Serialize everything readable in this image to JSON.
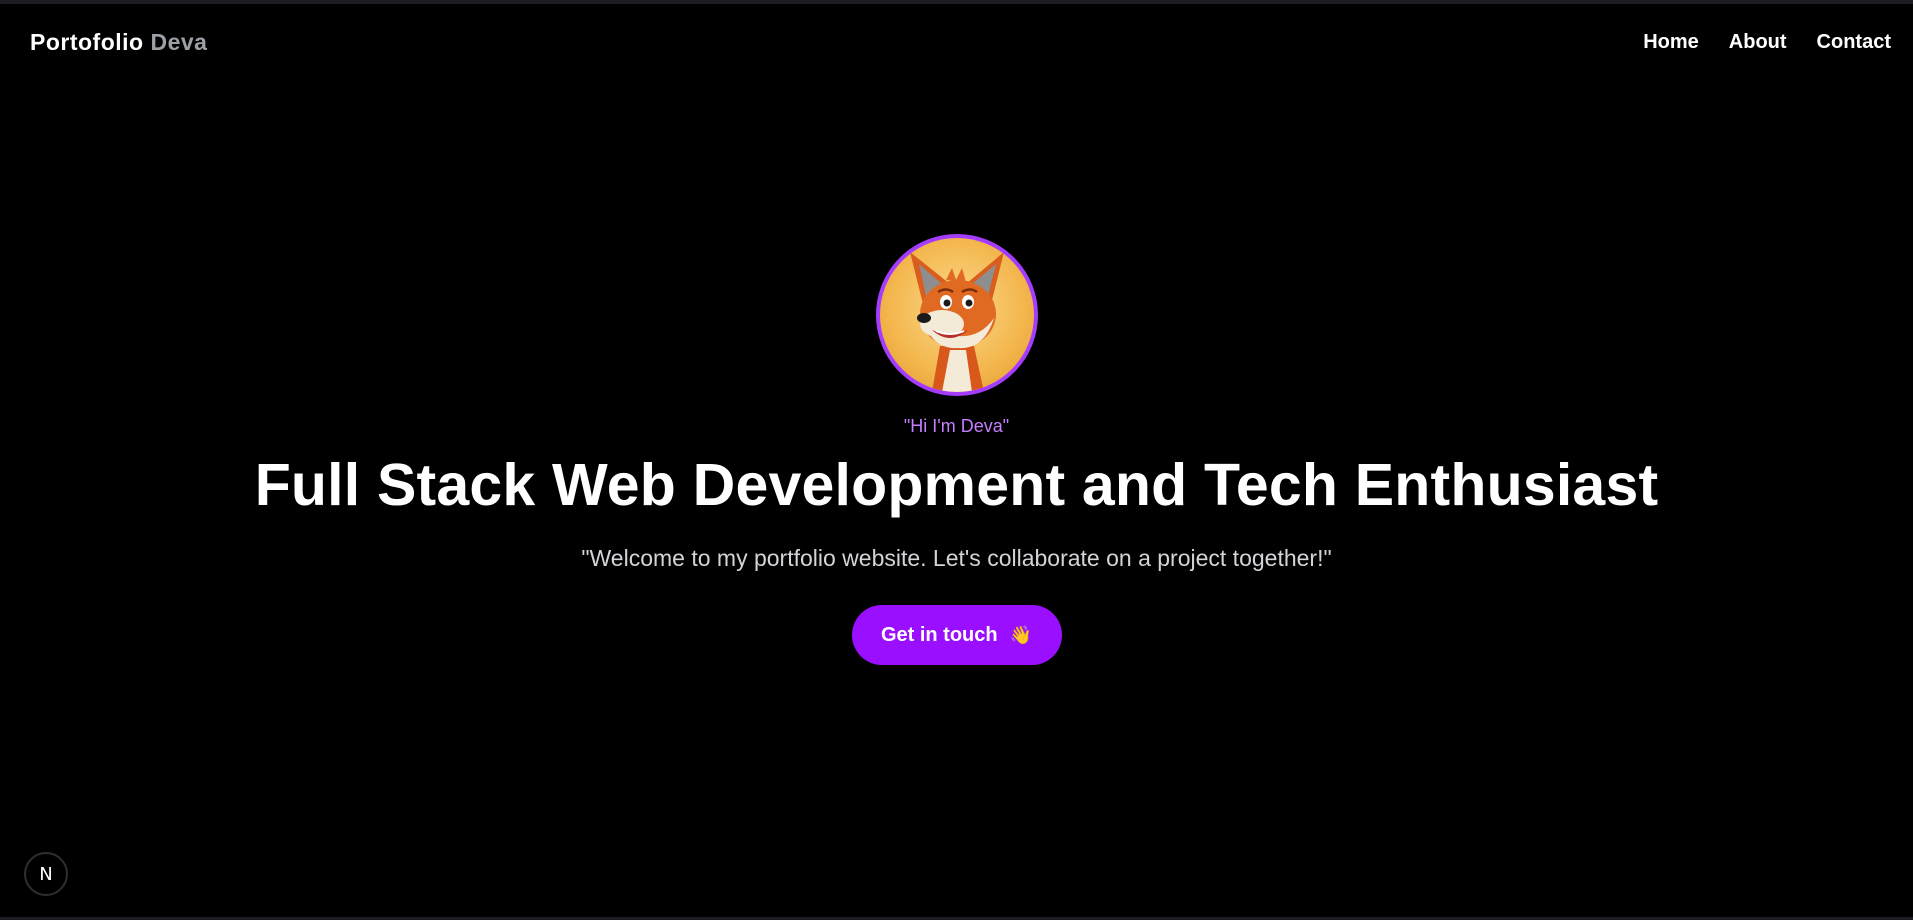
{
  "header": {
    "brand_primary": "Portofolio",
    "brand_secondary": "Deva",
    "nav": [
      {
        "label": "Home"
      },
      {
        "label": "About"
      },
      {
        "label": "Contact"
      }
    ]
  },
  "hero": {
    "avatar_icon": "fox-cartoon-avatar",
    "greeting": "\"Hi I'm Deva\"",
    "headline": "Full Stack Web Development and Tech Enthusiast",
    "tagline": "\"Welcome to my portfolio website. Let's collaborate on a project together!\"",
    "cta_label": "Get in touch",
    "cta_emoji": "👋"
  },
  "dev_badge": {
    "icon": "nextjs-icon",
    "label": "N"
  },
  "colors": {
    "background": "#000000",
    "accent": "#9a0fff",
    "avatar_ring": "#a43cff",
    "greeting": "#c77dff",
    "brand_muted": "#9aa0a6"
  }
}
